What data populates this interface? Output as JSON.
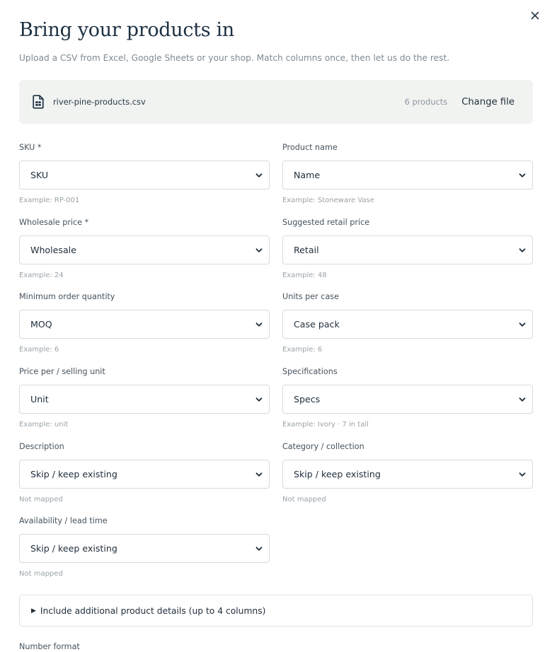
{
  "dialog": {
    "title": "Bring your products in",
    "subtitle": "Upload a CSV from Excel, Google Sheets or your shop. Match columns once, then let us do the rest.",
    "close_icon": "close-icon"
  },
  "file": {
    "icon": "csv-file-icon",
    "name": "river-pine-products.csv",
    "count": "6 products",
    "change_label": "Change file"
  },
  "fields": [
    {
      "label": "SKU *",
      "value": "SKU",
      "hint": "Example: RP-001"
    },
    {
      "label": "Product name",
      "value": "Name",
      "hint": "Example: Stoneware Vase"
    },
    {
      "label": "Wholesale price *",
      "value": "Wholesale",
      "hint": "Example: 24"
    },
    {
      "label": "Suggested retail price",
      "value": "Retail",
      "hint": "Example: 48"
    },
    {
      "label": "Minimum order quantity",
      "value": "MOQ",
      "hint": "Example: 6"
    },
    {
      "label": "Units per case",
      "value": "Case pack",
      "hint": "Example: 6"
    },
    {
      "label": "Price per / selling unit",
      "value": "Unit",
      "hint": "Example: unit"
    },
    {
      "label": "Specifications",
      "value": "Specs",
      "hint": "Example: Ivory · 7 in tall"
    },
    {
      "label": "Description",
      "value": "Skip / keep existing",
      "hint": "Not mapped"
    },
    {
      "label": "Category / collection",
      "value": "Skip / keep existing",
      "hint": "Not mapped"
    },
    {
      "label": "Availability / lead time",
      "value": "Skip / keep existing",
      "hint": "Not mapped"
    }
  ],
  "details": {
    "label": "Include additional product details (up to 4 columns)",
    "expanded": false
  },
  "number_format": {
    "label": "Number format"
  },
  "colors": {
    "title": "#1d3143",
    "text": "#1f2d3a",
    "muted": "#7e8b94",
    "file_bar_bg": "#f1f3f1",
    "border": "#d6dadd"
  }
}
